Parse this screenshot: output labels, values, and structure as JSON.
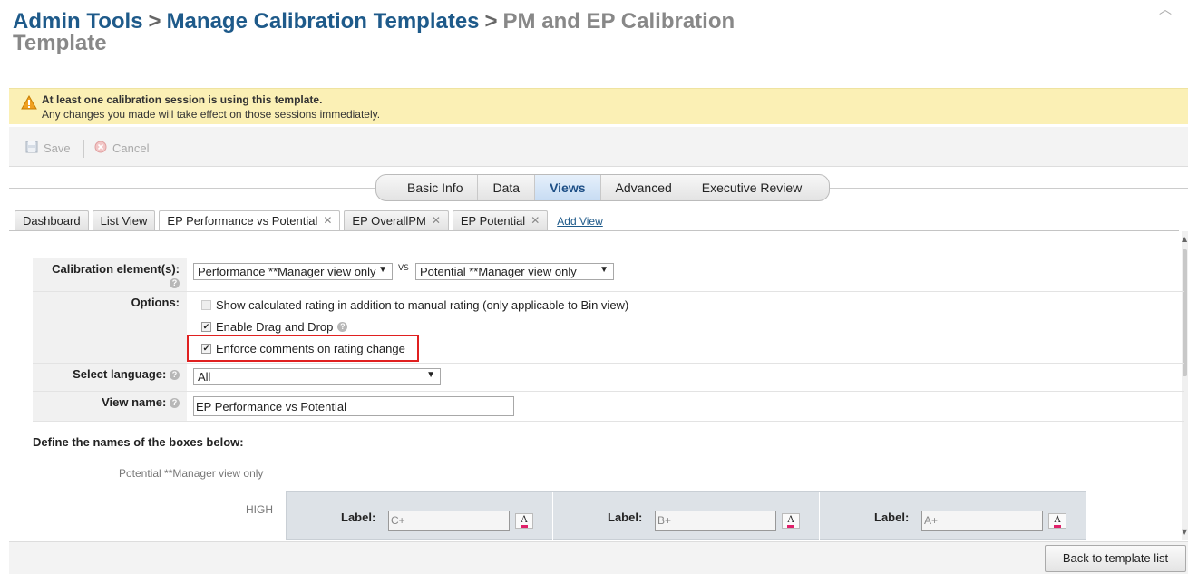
{
  "breadcrumb": {
    "admin_tools": "Admin Tools",
    "manage_templates": "Manage Calibration Templates",
    "current": "PM and EP Calibration Template",
    "separator": ">"
  },
  "warning": {
    "title": "At least one calibration session is using this template.",
    "message": "Any changes you made will take effect on those sessions immediately."
  },
  "toolbar": {
    "save_label": "Save",
    "cancel_label": "Cancel"
  },
  "main_tabs": [
    "Basic Info",
    "Data",
    "Views",
    "Advanced",
    "Executive Review"
  ],
  "active_main_tab": "Views",
  "sub_tabs": [
    "Dashboard",
    "List View",
    "EP Performance vs Potential",
    "EP OverallPM",
    "EP Potential"
  ],
  "add_view_label": "Add View",
  "form": {
    "calibration_label": "Calibration element(s):",
    "element1": "Performance **Manager view only",
    "vs": "VS",
    "element2": "Potential **Manager view only",
    "options_label": "Options:",
    "opt_show_calculated": "Show calculated rating in addition to manual rating (only applicable to Bin view)",
    "opt_drag_drop": "Enable Drag and Drop",
    "opt_enforce_comments": "Enforce comments on rating change",
    "language_label": "Select language:",
    "language_value": "All",
    "view_name_label": "View name:",
    "view_name_value": "EP Performance vs Potential"
  },
  "boxes": {
    "title": "Define the names of the boxes below:",
    "axis_label": "Potential **Manager view only",
    "row_label": "HIGH",
    "label_text": "Label:",
    "cells": [
      "C+",
      "B+",
      "A+"
    ],
    "color_glyph": "A"
  },
  "footer": {
    "back_label": "Back to template list"
  },
  "colors": {
    "link": "#1e5a8a",
    "warning_bg": "#fbf0b5",
    "highlight": "#e02020",
    "active_tab": "#c7dcf3"
  }
}
